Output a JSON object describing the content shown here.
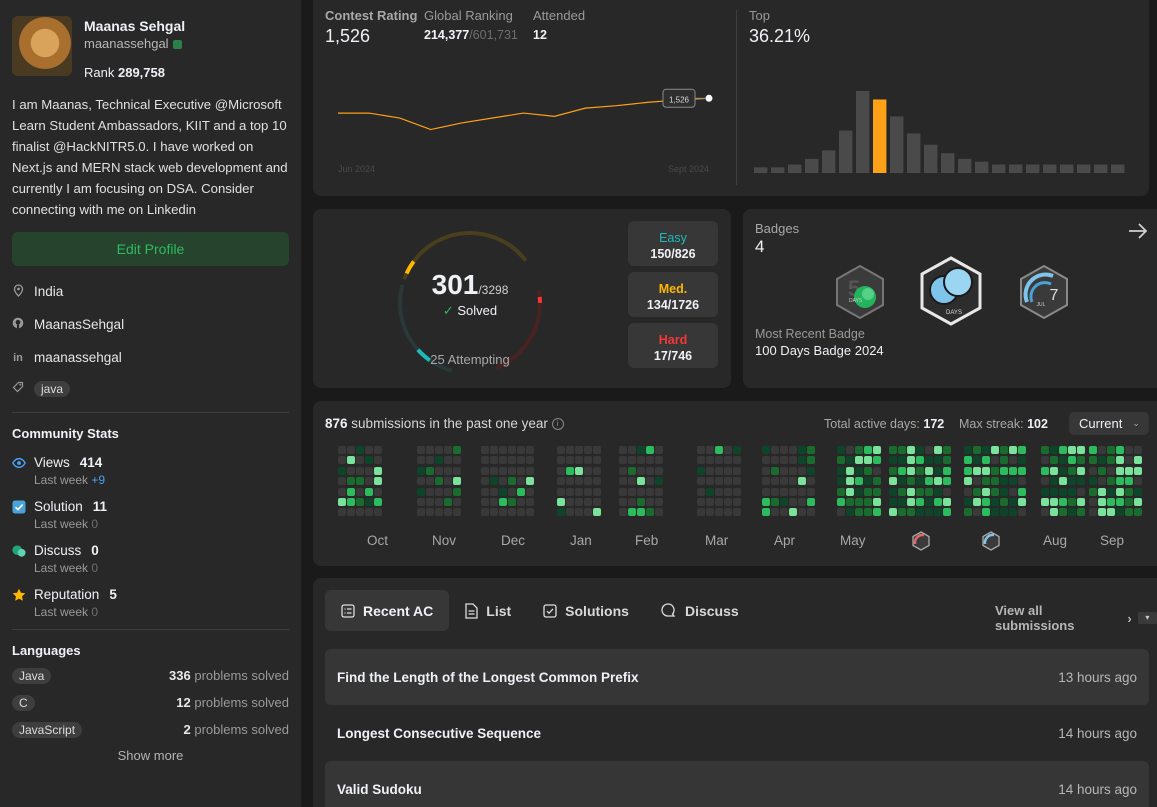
{
  "profile": {
    "name": "Maanas Sehgal",
    "username": "maanassehgal",
    "rank_label": "Rank",
    "rank_value": "289,758",
    "bio": "I am Maanas, Technical Executive @Microsoft Learn Student Ambassadors, KIIT and a top 10 finalist @HackNITR5.0. I have worked on Next.js and MERN stack web development and currently I am focusing on DSA. Consider connecting with me on Linkedin",
    "edit_label": "Edit Profile",
    "location": "India",
    "github": "MaanasSehgal",
    "linkedin": "maanassehgal",
    "skill_tag": "java"
  },
  "community": {
    "title": "Community Stats",
    "views_label": "Views",
    "views_value": "414",
    "views_week_label": "Last week",
    "views_week_value": "+9",
    "solution_label": "Solution",
    "solution_value": "11",
    "solution_week_label": "Last week",
    "solution_week_value": "0",
    "discuss_label": "Discuss",
    "discuss_value": "0",
    "discuss_week_label": "Last week",
    "discuss_week_value": "0",
    "reputation_label": "Reputation",
    "reputation_value": "5",
    "reputation_week_label": "Last week",
    "reputation_week_value": "0"
  },
  "languages": {
    "title": "Languages",
    "items": [
      {
        "name": "Java",
        "count": "336",
        "suffix": "problems solved"
      },
      {
        "name": "C",
        "count": "12",
        "suffix": "problems solved"
      },
      {
        "name": "JavaScript",
        "count": "2",
        "suffix": "problems solved"
      }
    ],
    "show_more": "Show more"
  },
  "contest": {
    "rating_label": "Contest Rating",
    "rating_value": "1,526",
    "global_label": "Global Ranking",
    "global_value": "214,377",
    "global_total": "/601,731",
    "attended_label": "Attended",
    "attended_value": "12",
    "top_label": "Top",
    "top_value": "36.21%",
    "tooltip": "1,526",
    "start_label": "Jun 2024",
    "end_label": "Sept 2024"
  },
  "solved": {
    "count": "301",
    "total": "/3298",
    "solved_label": "Solved",
    "attempting": "25 Attempting",
    "easy_label": "Easy",
    "easy_value": "150/826",
    "med_label": "Med.",
    "med_value": "134/1726",
    "hard_label": "Hard",
    "hard_value": "17/746",
    "colors": {
      "easy": "#1cbaba",
      "medium": "#ffb700",
      "hard": "#f63737"
    }
  },
  "badges": {
    "label": "Badges",
    "count": "4",
    "recent_label": "Most Recent Badge",
    "recent_name": "100 Days Badge 2024",
    "badge_texts": [
      "DAYS",
      "DAYS",
      "JUL",
      "7"
    ]
  },
  "submissions": {
    "count": "876",
    "text": "submissions in the past one year",
    "active_label": "Total active days:",
    "active_value": "172",
    "streak_label": "Max streak:",
    "streak_value": "102",
    "select_value": "Current",
    "months": [
      "Oct",
      "Nov",
      "Dec",
      "Jan",
      "Feb",
      "Mar",
      "Apr",
      "May",
      "Aug",
      "Sep"
    ]
  },
  "recent": {
    "tabs": [
      "Recent AC",
      "List",
      "Solutions",
      "Discuss"
    ],
    "view_all": "View all submissions",
    "items": [
      {
        "title": "Find the Length of the Longest Common Prefix",
        "time": "13 hours ago"
      },
      {
        "title": "Longest Consecutive Sequence",
        "time": "14 hours ago"
      },
      {
        "title": "Valid Sudoku",
        "time": "14 hours ago"
      }
    ]
  },
  "chart_data": [
    {
      "type": "line",
      "title": "",
      "x": [
        1,
        2,
        3,
        4,
        5,
        6,
        7,
        8,
        9,
        10,
        11,
        12,
        13
      ],
      "values": [
        1508,
        1508,
        1502,
        1488,
        1496,
        1502,
        1508,
        1504,
        1514,
        1517,
        1521,
        1524,
        1526
      ],
      "ylabel": "",
      "xlabel": "",
      "xticks": [
        "Jun 2024",
        "Sept 2024"
      ]
    },
    {
      "type": "bar",
      "title": "",
      "values": [
        4,
        4,
        6,
        10,
        16,
        30,
        58,
        52,
        40,
        28,
        20,
        14,
        10,
        8,
        6,
        6,
        6,
        6,
        6,
        6,
        6,
        6
      ],
      "highlight_index": 7,
      "colors": {
        "bar": "#4a4a4a",
        "highlight": "#ffa116"
      }
    }
  ]
}
